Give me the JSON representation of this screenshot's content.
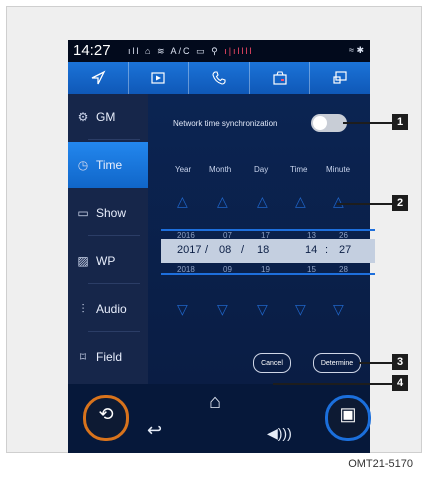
{
  "caption": "OMT21-5170",
  "status_bar": {
    "time": "14:27",
    "left_icons": "ᵢₗₗ ⌂ ☁ A/C ▭ ⚲",
    "right_icons": "≈ ✱ ✱"
  },
  "top_nav": [
    {
      "icon": "navigation-arrow-icon"
    },
    {
      "icon": "media-play-icon"
    },
    {
      "icon": "phone-icon"
    },
    {
      "icon": "car-folder-icon"
    },
    {
      "icon": "display-icon"
    }
  ],
  "sidebar": {
    "items": [
      {
        "label": "GM",
        "icon": "gear-icon",
        "glyph": "⚙"
      },
      {
        "label": "Time",
        "icon": "clock-icon",
        "glyph": "◷",
        "active": true
      },
      {
        "label": "Show",
        "icon": "screen-icon",
        "glyph": "▭"
      },
      {
        "label": "WP",
        "icon": "wallpaper-icon",
        "glyph": "▨"
      },
      {
        "label": "Audio",
        "icon": "equalizer-icon",
        "glyph": "⫶"
      },
      {
        "label": "Field",
        "icon": "sound-field-icon",
        "glyph": "⌑"
      }
    ]
  },
  "time_settings": {
    "sync_label": "Network time synchronization",
    "sync_enabled": false,
    "columns": [
      "Year",
      "Month",
      "Day",
      "Time",
      "Minute"
    ],
    "prev_row": [
      "2016",
      "07",
      "17",
      "13",
      "26"
    ],
    "selected_row": {
      "year": "2017",
      "month": "08",
      "day": "18",
      "hour": "14",
      "minute": "27"
    },
    "next_row": [
      "2018",
      "09",
      "19",
      "15",
      "28"
    ],
    "cancel_label": "Cancel",
    "determine_label": "Determine"
  },
  "callouts": [
    "1",
    "2",
    "3",
    "4"
  ],
  "colors": {
    "accent": "#1b73d8",
    "screen_bg": "#06183a",
    "left_dial": "#d8731c",
    "right_dial": "#1b6fdc"
  }
}
